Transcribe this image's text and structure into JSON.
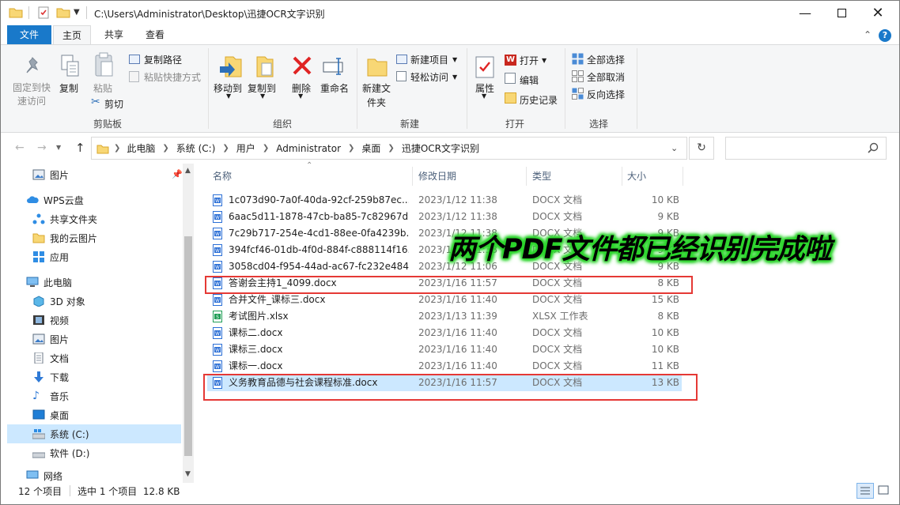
{
  "window": {
    "title": "C:\\Users\\Administrator\\Desktop\\迅捷OCR文字识别"
  },
  "tabs": {
    "file": "文件",
    "home": "主页",
    "share": "共享",
    "view": "查看"
  },
  "ribbon": {
    "pin": "固定到快速访问",
    "copy": "复制",
    "paste": "粘贴",
    "copy_path": "复制路径",
    "paste_shortcut": "粘贴快捷方式",
    "cut": "剪切",
    "group_clipboard": "剪贴板",
    "move_to": "移动到",
    "copy_to": "复制到",
    "delete": "删除",
    "rename": "重命名",
    "group_organize": "组织",
    "new_folder": "新建文件夹",
    "new_item": "新建项目",
    "easy_access": "轻松访问",
    "group_new": "新建",
    "properties": "属性",
    "open": "打开",
    "edit": "编辑",
    "history": "历史记录",
    "group_open": "打开",
    "select_all": "全部选择",
    "select_none": "全部取消",
    "invert_selection": "反向选择",
    "group_select": "选择"
  },
  "address": {
    "crumbs": [
      "此电脑",
      "系统 (C:)",
      "用户",
      "Administrator",
      "桌面",
      "迅捷OCR文字识别"
    ],
    "search_placeholder": ""
  },
  "nav": {
    "items": [
      "图片",
      "WPS云盘",
      "共享文件夹",
      "我的云图片",
      "应用",
      "此电脑",
      "3D 对象",
      "视频",
      "图片",
      "文档",
      "下载",
      "音乐",
      "桌面",
      "系统 (C:)",
      "软件 (D:)",
      "网络"
    ]
  },
  "columns": {
    "name": "名称",
    "date": "修改日期",
    "type": "类型",
    "size": "大小"
  },
  "files": [
    {
      "name": "1c073d90-7a0f-40da-92cf-259b87ec...",
      "date": "2023/1/12 11:38",
      "type": "DOCX 文档",
      "size": "10 KB",
      "kind": "docx"
    },
    {
      "name": "6aac5d11-1878-47cb-ba85-7c82967d...",
      "date": "2023/1/12 11:38",
      "type": "DOCX 文档",
      "size": "9 KB",
      "kind": "docx"
    },
    {
      "name": "7c29b717-254e-4cd1-88ee-0fa4239b...",
      "date": "2023/1/12 11:38",
      "type": "DOCX 文档",
      "size": "9 KB",
      "kind": "docx"
    },
    {
      "name": "394fcf46-01db-4f0d-884f-c888114f16...",
      "date": "2023/1/12 11:38",
      "type": "DOCX 文档",
      "size": "9 KB",
      "kind": "docx"
    },
    {
      "name": "3058cd04-f954-44ad-ac67-fc232e484...",
      "date": "2023/1/12 11:06",
      "type": "DOCX 文档",
      "size": "9 KB",
      "kind": "docx"
    },
    {
      "name": "答谢会主持1_4099.docx",
      "date": "2023/1/16 11:57",
      "type": "DOCX 文档",
      "size": "8 KB",
      "kind": "docx"
    },
    {
      "name": "合并文件_课标三.docx",
      "date": "2023/1/16 11:40",
      "type": "DOCX 文档",
      "size": "15 KB",
      "kind": "docx"
    },
    {
      "name": "考试图片.xlsx",
      "date": "2023/1/13 11:39",
      "type": "XLSX 工作表",
      "size": "8 KB",
      "kind": "xlsx"
    },
    {
      "name": "课标二.docx",
      "date": "2023/1/16 11:40",
      "type": "DOCX 文档",
      "size": "10 KB",
      "kind": "docx"
    },
    {
      "name": "课标三.docx",
      "date": "2023/1/16 11:40",
      "type": "DOCX 文档",
      "size": "10 KB",
      "kind": "docx"
    },
    {
      "name": "课标一.docx",
      "date": "2023/1/16 11:40",
      "type": "DOCX 文档",
      "size": "11 KB",
      "kind": "docx"
    },
    {
      "name": "义务教育品德与社会课程标准.docx",
      "date": "2023/1/16 11:57",
      "type": "DOCX 文档",
      "size": "13 KB",
      "kind": "docx"
    }
  ],
  "overlay": {
    "text": "两个PDF文件都已经识别完成啦"
  },
  "status": {
    "count": "12 个项目",
    "selected": "选中 1 个项目  12.8 KB"
  },
  "colors": {
    "accent": "#1979ca",
    "selection": "#cce8ff",
    "highlight_box": "#e53935",
    "overlay_text": "#000000",
    "overlay_glow": "#2bd42b"
  }
}
